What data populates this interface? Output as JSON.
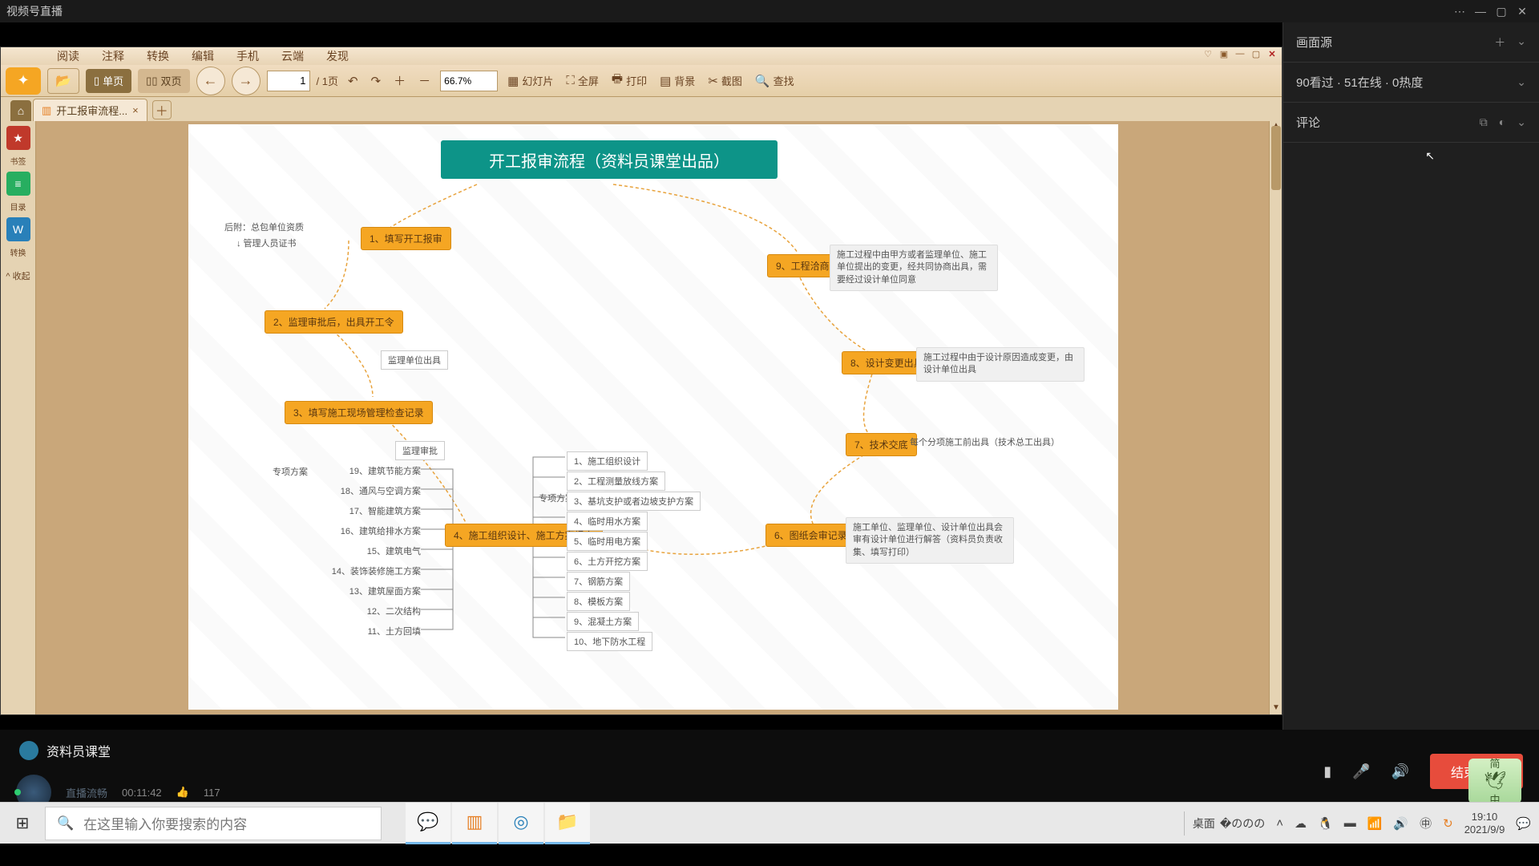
{
  "titlebar": {
    "title": "视频号直播"
  },
  "pdf": {
    "menu": [
      "阅读",
      "注释",
      "转换",
      "编辑",
      "手机",
      "云端",
      "发现"
    ],
    "toolbar": {
      "single": "单页",
      "double": "双页",
      "page_current": "1",
      "page_total": "/ 1页",
      "zoom": "66.7%",
      "slide": "幻灯片",
      "full": "全屏",
      "print": "打印",
      "bg": "背景",
      "crop": "截图",
      "find": "查找"
    },
    "tab": {
      "name": "开工报审流程...",
      "close": "×"
    },
    "sidebar": {
      "bookmark": "书签",
      "toc": "目录",
      "convert": "转换",
      "collapse": "^ 收起"
    }
  },
  "mindmap": {
    "title": "开工报审流程（资料员课堂出品）",
    "n1": "1、填写开工报审",
    "n1a": "后附：总包单位资质",
    "n1b": "↓ 管理人员证书",
    "n2": "2、监理审批后，出具开工令",
    "n2a": "监理单位出具",
    "n3": "3、填写施工现场管理检查记录",
    "n3a": "监理审批",
    "n4": "4、施工组织设计、施工方案报审",
    "n4_left_label": "专项方案",
    "n4_right_label": "专项方案",
    "left_items": [
      "19、建筑节能方案",
      "18、通风与空调方案",
      "17、智能建筑方案",
      "16、建筑给排水方案",
      "15、建筑电气",
      "14、装饰装修施工方案",
      "13、建筑屋面方案",
      "12、二次结构",
      "11、土方回填"
    ],
    "right_items": [
      "1、施工组织设计",
      "2、工程测量放线方案",
      "3、基坑支护或者边坡支护方案",
      "4、临时用水方案",
      "5、临时用电方案",
      "6、土方开挖方案",
      "7、钢筋方案",
      "8、模板方案",
      "9、混凝土方案",
      "10、地下防水工程"
    ],
    "n6": "6、图纸会审记录",
    "n6a": "施工单位、监理单位、设计单位出具会审有设计单位进行解答（资料员负责收集、填写打印）",
    "n7": "7、技术交底",
    "n7a": "每个分项施工前出具（技术总工出具）",
    "n8": "8、设计变更出具",
    "n8a": "施工过程中由于设计原因造成变更，由设计单位出具",
    "n9": "9、工程洽商",
    "n9a": "施工过程中由甲方或者监理单位、施工单位提出的变更，经共同协商出具，需要经过设计单位同意"
  },
  "right": {
    "source_label": "画面源",
    "stats": "90看过 · 51在线 · 0热度",
    "comments": "评论"
  },
  "info": {
    "channel": "资料员课堂",
    "status": "直播流畅",
    "time": "00:11:42",
    "likes": "117",
    "end": "结束直播",
    "ime1": "简",
    "ime2": "中"
  },
  "taskbar": {
    "search_placeholder": "在这里输入你要搜索的内容",
    "desktop": "桌面",
    "time": "19:10",
    "date": "2021/9/9"
  }
}
